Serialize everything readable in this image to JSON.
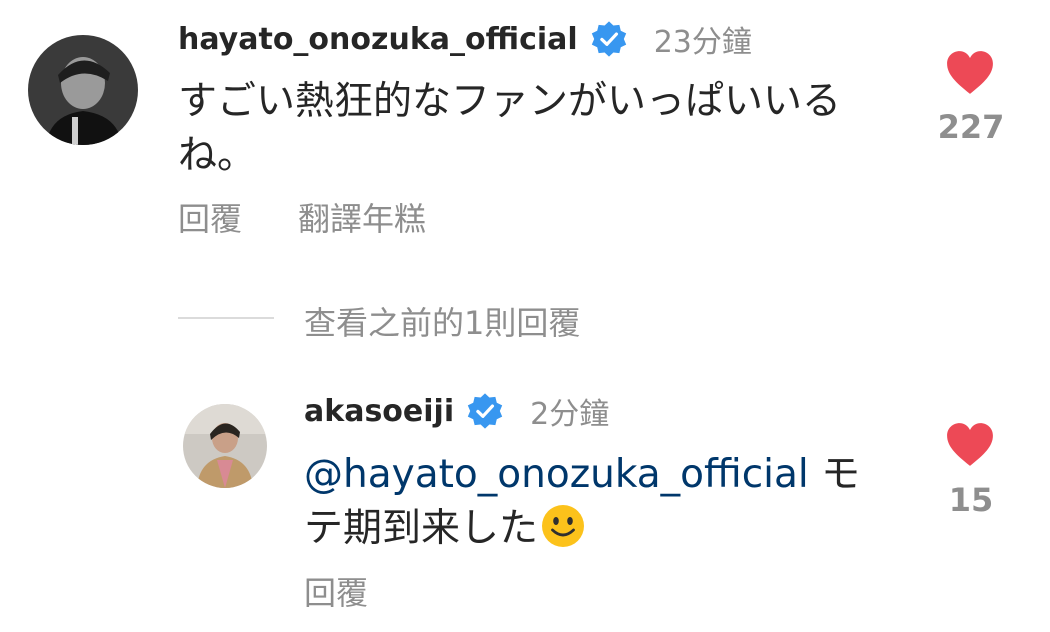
{
  "comment": {
    "username": "hayato_onozuka_official",
    "time": "23分鐘",
    "text": "すごい熱狂的なファンがいっぱいいるね。",
    "reply_label": "回覆",
    "translate_label": "翻譯年糕",
    "like_count": "227"
  },
  "thread": {
    "view_previous_label": "查看之前的1則回覆"
  },
  "reply": {
    "username": "akasoeiji",
    "time": "2分鐘",
    "mention": "@hayato_onozuka_official",
    "text": " モテ期到来した",
    "emoji": "smiling-face-emoji",
    "reply_label": "回覆",
    "like_count": "15"
  },
  "colors": {
    "heart": "#ed4956",
    "verified": "#3897f0",
    "mention": "#00376b",
    "secondary_text": "#8e8e8e"
  }
}
